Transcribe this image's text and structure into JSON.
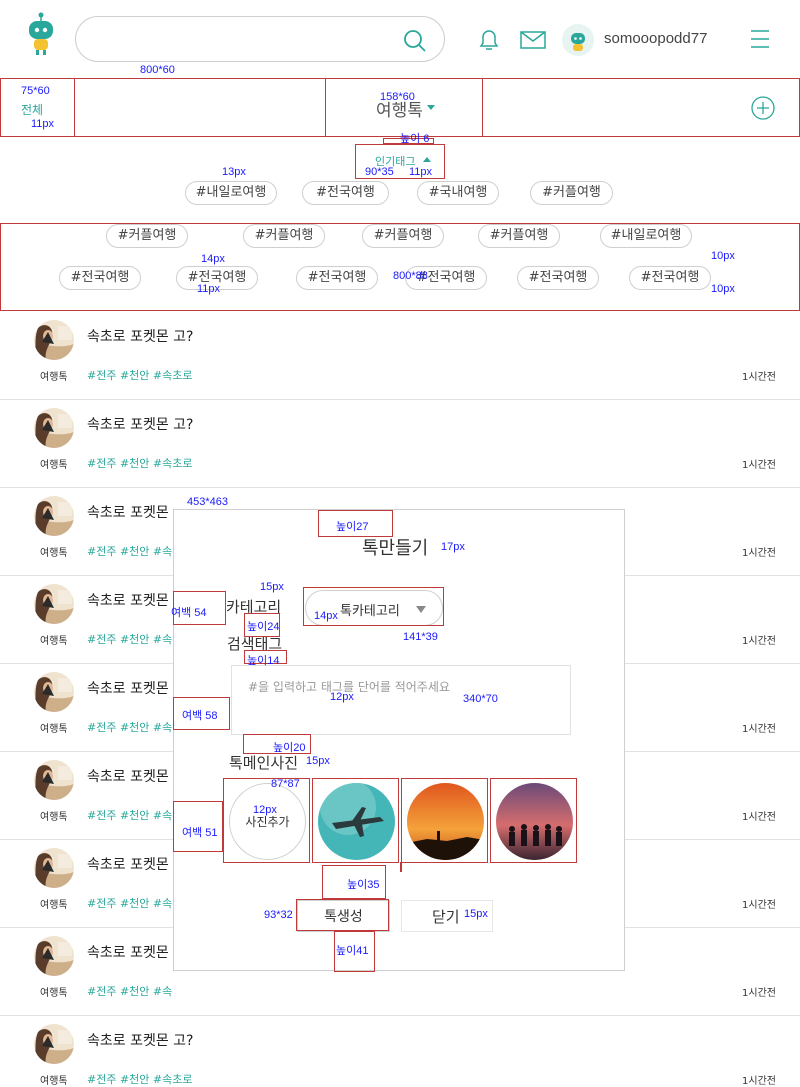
{
  "header": {
    "search_placeholder": "",
    "username": "somooopodd77"
  },
  "category_bar": {
    "all_label": "전체",
    "title": "여행톡",
    "popular_label": "인기태그"
  },
  "popular_tags": [
    "#내일로여행",
    "#전국여행",
    "#국내여행",
    "#커플여행"
  ],
  "tag_rows": [
    [
      "#커플여행",
      "#커플여행",
      "#커플여행",
      "#커플여행",
      "#내일로여행"
    ],
    [
      "#전국여행",
      "#전국여행",
      "#전국여행",
      "#전국여행",
      "#전국여행",
      "#전국여행"
    ]
  ],
  "feed": {
    "title_full": "속초로 포켓몬 고?",
    "title_short": "속초로 포켓몬",
    "category": "여행톡",
    "tags_full": "#전주 #천안 #속초로",
    "tags_short": "#전주 #천안 #속",
    "time": "1시간전"
  },
  "modal": {
    "title": "톡만들기",
    "category_label": "카테고리",
    "category_select": "톡카테고리",
    "tag_label": "검색태그",
    "tag_placeholder": "#을 입력하고 태그를 단어를 적어주세요",
    "photo_label": "톡메인사진",
    "photo_add": "사진추가",
    "create_button": "톡생성",
    "close_button": "닫기"
  },
  "annotations": {
    "a1": "800*60",
    "a2": "75*60",
    "a3": "11px",
    "a4": "158*60",
    "a5": "높이 6",
    "a6": "90*35",
    "a7": "11px",
    "a8": "13px",
    "a9": "14px",
    "a10": "11px",
    "a11": "800*88",
    "a12": "10px",
    "a13": "10px",
    "a14": "453*463",
    "a15": "높이27",
    "a16": "17px",
    "a17": "15px",
    "a18": "여백 54",
    "a19": "높이24",
    "a20": "14px",
    "a21": "141*39",
    "a22": "높이14",
    "a23": "12px",
    "a24": "340*70",
    "a25": "여백 58",
    "a26": "높이20",
    "a27": "15px",
    "a28": "87*87",
    "a29": "12px",
    "a30": "여백 51",
    "a31": "높이35",
    "a32": "93*32",
    "a33": "15px",
    "a34": "높이41"
  },
  "colors": {
    "accent": "#2aa79b",
    "annotation": "#1a1aff",
    "annotation_box": "#c0393b"
  }
}
